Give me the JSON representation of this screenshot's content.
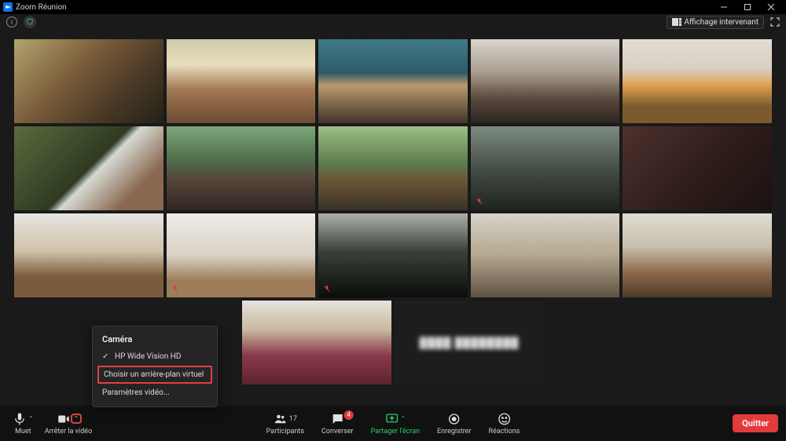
{
  "window": {
    "title": "Zoom Réunion"
  },
  "topbar": {
    "view_label": "Affichage intervenant"
  },
  "gallery": {
    "name_tile_placeholder": "████ ████████"
  },
  "camera_menu": {
    "heading": "Caméra",
    "selected_camera": "HP Wide Vision HD",
    "choose_bg": "Choisir un arrière-plan virtuel",
    "settings": "Paramètres vidéo..."
  },
  "toolbar": {
    "mute": "Muet",
    "stop_video": "Arrêter la vidéo",
    "participants": "Participants",
    "participants_count": "17",
    "chat": "Converser",
    "chat_badge": "4",
    "share": "Partager l'écran",
    "record": "Enregistrer",
    "reactions": "Réactions",
    "leave": "Quitter"
  }
}
